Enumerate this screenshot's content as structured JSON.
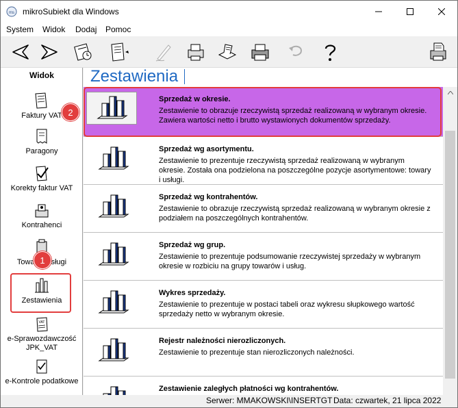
{
  "window": {
    "title": "mikroSubiekt dla Windows"
  },
  "menu": [
    "System",
    "Widok",
    "Dodaj",
    "Pomoc"
  ],
  "toolbar": {
    "buttons": [
      "back-arrow-icon",
      "forward-arrow-icon",
      "calendar-icon",
      "document-sign-icon",
      "pen-icon",
      "print-preview-icon",
      "receipt-icon",
      "printer-icon",
      "undo-icon",
      "help-icon",
      "fax-printer-icon"
    ]
  },
  "nav": {
    "heading": "Widok",
    "items": [
      {
        "label": "Faktury VAT",
        "icon": "invoice-icon"
      },
      {
        "label": "Paragony",
        "icon": "receipt-icon"
      },
      {
        "label": "Korekty faktur VAT",
        "icon": "correction-icon"
      },
      {
        "label": "Kontrahenci",
        "icon": "contractors-icon"
      },
      {
        "label": "Towary i usługi",
        "icon": "goods-icon"
      },
      {
        "label": "Zestawienia",
        "icon": "report-chart-icon"
      },
      {
        "label": "e-Sprawozdawczość JPK_VAT",
        "icon": "jpk-icon"
      },
      {
        "label": "e-Kontrole podatkowe",
        "icon": "tax-control-icon"
      }
    ]
  },
  "main": {
    "title": "Zestawienia",
    "reports": [
      {
        "title": "Sprzedaż w okresie.",
        "desc": "Zestawienie to obrazuje rzeczywistą sprzedaż realizowaną w wybranym okresie. Zawiera wartości netto i brutto wystawionych dokumentów sprzedaży."
      },
      {
        "title": "Sprzedaż wg asortymentu.",
        "desc": "Zestawienie to prezentuje rzeczywistą sprzedaż realizowaną w wybranym okresie. Została ona podzielona na poszczególne pozycje asortymentowe: towary i usługi."
      },
      {
        "title": "Sprzedaż wg kontrahentów.",
        "desc": "Zestawienie to obrazuje rzeczywistą sprzedaż realizowaną w wybranym okresie z podziałem na poszczególnych kontrahentów."
      },
      {
        "title": "Sprzedaż wg grup.",
        "desc": "Zestawienie to prezentuje podsumowanie rzeczywistej sprzedaży w wybranym okresie w rozbiciu na grupy towarów i usług."
      },
      {
        "title": "Wykres sprzedaży.",
        "desc": "Zestawienie to prezentuje w postaci tabeli oraz wykresu słupkowego wartość sprzedaży netto w wybranym okresie."
      },
      {
        "title": "Rejestr należności nierozliczonych.",
        "desc": "Zestawienie to prezentuje stan nierozliczonych należności."
      },
      {
        "title": "Zestawienie zaległych płatności wg kontrahentów.",
        "desc": ""
      }
    ]
  },
  "status": {
    "server": "Serwer: MMAKOWSKI\\INSERTGT",
    "date": "Data: czwartek, 21 lipca 2022"
  },
  "annotations": {
    "badge1": "1",
    "badge2": "2"
  },
  "colors": {
    "accent": "#1f69c3",
    "selected_row": "#c767e8",
    "highlight": "#e23d3d"
  }
}
